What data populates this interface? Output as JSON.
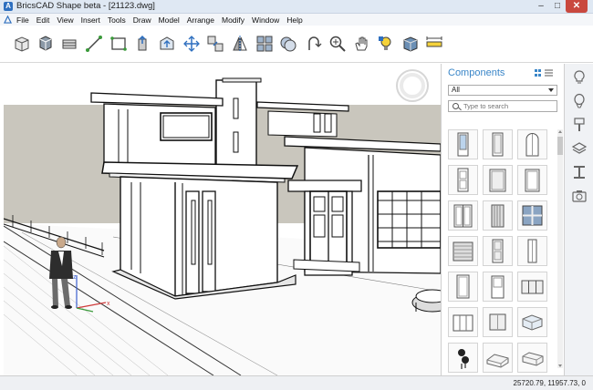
{
  "window": {
    "title": "BricsCAD Shape beta - [21123.dwg]",
    "controls": [
      "–",
      "□",
      "✕"
    ]
  },
  "menu": [
    "File",
    "Edit",
    "View",
    "Insert",
    "Tools",
    "Draw",
    "Model",
    "Arrange",
    "Modify",
    "Window",
    "Help"
  ],
  "toolbar": {
    "tools": [
      "box-icon",
      "cylinder-icon",
      "extrude-icon",
      "line-icon",
      "rectangle-icon",
      "push-pull-icon",
      "face-icon",
      "move-icon",
      "copy-icon",
      "mirror-icon",
      "array-icon",
      "union-icon",
      "rotate-icon",
      "zoom-icon",
      "pan-icon",
      "light-icon",
      "material-icon",
      "dimension-icon"
    ]
  },
  "components": {
    "title": "Components",
    "filter": "All",
    "search_placeholder": "Type to search",
    "items": [
      "door-glass",
      "door-panel",
      "door-arched",
      "door-single",
      "door-double-panel",
      "door-framed",
      "door-double",
      "door-slatted",
      "window-four-pane",
      "garage-door",
      "door-narrow",
      "door-tall",
      "door-plain",
      "door-wide",
      "window-triple",
      "door-cabinet",
      "door-square",
      "block-3d",
      "person-figure",
      "profile-angle",
      "profile-channel"
    ]
  },
  "rail": [
    "bulb-icon",
    "balloon-icon",
    "brush-icon",
    "layers-icon",
    "beam-icon",
    "camera-icon"
  ],
  "status": {
    "coordinates": "25720.79, 11957.73, 0"
  },
  "colors": {
    "accent": "#3a86c8",
    "close": "#c9483e"
  }
}
